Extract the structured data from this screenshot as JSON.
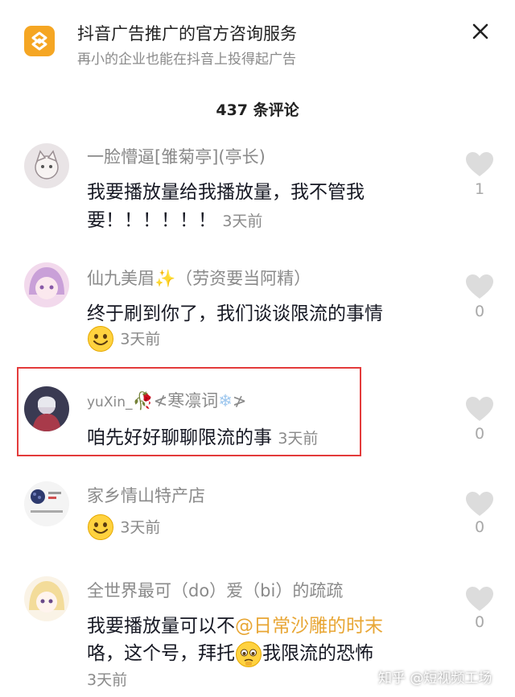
{
  "ad": {
    "title": "抖音广告推广的官方咨询服务",
    "subtitle": "再小的企业也能在抖音上投得起广告",
    "accent": "#f5a623"
  },
  "comment_count": "437 条评论",
  "comments": [
    {
      "username": "一脸懵逼[雏菊亭](亭长)",
      "line1": "我要播放量给我播放量，我不管我",
      "line2": "要！！！！！！",
      "time": "3天前",
      "likes": "1"
    },
    {
      "username": "仙九美眉",
      "username_suffix": "（劳资要当阿精）",
      "line1": "终于刷到你了，我们谈谈限流的事情",
      "time": "3天前",
      "likes": "0"
    },
    {
      "username_prefix": "yuXin_",
      "username": "≮寒凛词",
      "username_suffix": "≯",
      "line1": "咱先好好聊聊限流的事",
      "time": "3天前",
      "likes": "0"
    },
    {
      "username": "家乡情山特产店",
      "time": "3天前",
      "likes": "0"
    },
    {
      "username": "全世界最可（do）爱（bi）的疏疏",
      "line1_text": "我要播放量可以不",
      "line1_mention": "@日常沙雕的时末",
      "line2_a": "咯，这个号，拜托",
      "line2_b": "我限流的恐怖",
      "time": "3天前",
      "likes": "0"
    }
  ],
  "watermark": "知乎 @短视频工场",
  "colors": {
    "highlight": "#e33b3b",
    "mention": "#e8a634",
    "muted": "#8a8a8a"
  }
}
